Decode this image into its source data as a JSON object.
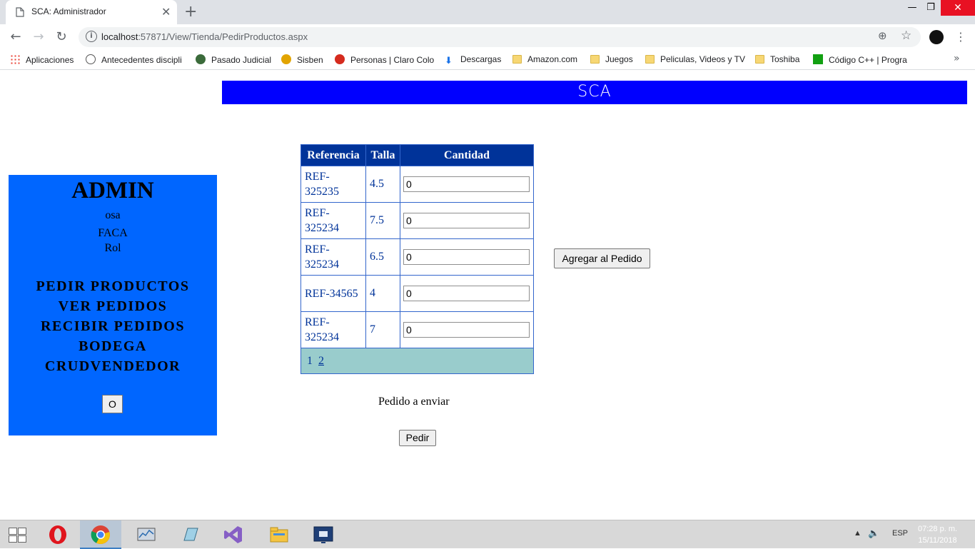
{
  "browser": {
    "tab_title": "SCA: Administrador",
    "url_host": "localhost",
    "url_rest": ":57871/View/Tienda/PedirProductos.aspx",
    "bookmarks": [
      {
        "label": "Aplicaciones",
        "icon": "apps-grid-icon"
      },
      {
        "label": "Antecedentes discipli",
        "icon": "procuraduria-icon"
      },
      {
        "label": "Pasado Judicial",
        "icon": "policia-icon"
      },
      {
        "label": "Sisben",
        "icon": "sisben-icon"
      },
      {
        "label": "Personas | Claro Colo",
        "icon": "claro-icon"
      },
      {
        "label": "Descargas",
        "icon": "download-icon"
      },
      {
        "label": "Amazon.com",
        "icon": "folder-icon"
      },
      {
        "label": "Juegos",
        "icon": "folder-icon"
      },
      {
        "label": "Peliculas, Videos y TV",
        "icon": "folder-icon"
      },
      {
        "label": "Toshiba",
        "icon": "folder-icon"
      },
      {
        "label": "Código C++ | Progra",
        "icon": "code-icon"
      }
    ]
  },
  "header": {
    "title": "SCA",
    "color": "#0000ff"
  },
  "sidebar": {
    "role_title": "ADMIN",
    "user": "osa",
    "org": "FACA",
    "rol": "Rol",
    "menu": [
      "PEDIR PRODUCTOS",
      "VER PEDIDOS",
      "RECIBIR PEDIDOS",
      "BODEGA",
      "CRUDVENDEDOR"
    ],
    "logout_label": "O",
    "color": "#0066ff"
  },
  "grid": {
    "columns": [
      "Referencia",
      "Talla",
      "Cantidad"
    ],
    "rows": [
      {
        "ref": "REF-325235",
        "talla": "4.5",
        "cantidad": "0"
      },
      {
        "ref": "REF-325234",
        "talla": "7.5",
        "cantidad": "0"
      },
      {
        "ref": "REF-325234",
        "talla": "6.5",
        "cantidad": "0"
      },
      {
        "ref": "REF-34565",
        "talla": "4",
        "cantidad": "0"
      },
      {
        "ref": "REF-325234",
        "talla": "7",
        "cantidad": "0"
      }
    ],
    "pager": {
      "current": "1",
      "other": "2"
    }
  },
  "actions": {
    "add_label": "Agregar al Pedido",
    "order_label": "Pedido a enviar",
    "submit_label": "Pedir"
  },
  "taskbar": {
    "lang": "ESP",
    "time": "07:28 p. m.",
    "date": "15/11/2018"
  }
}
